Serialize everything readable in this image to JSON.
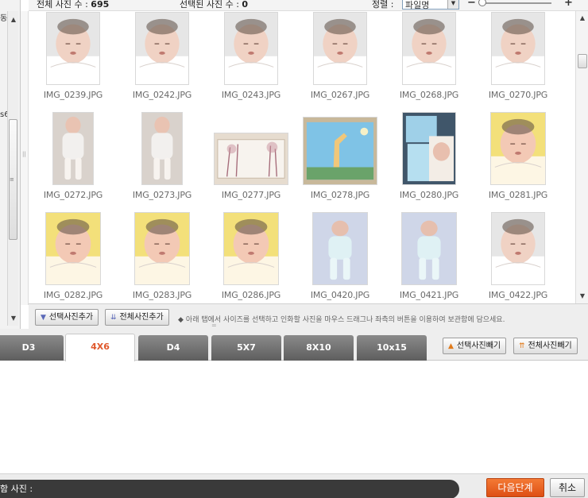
{
  "header": {
    "total_label": "전체 사진 수 : ",
    "total_count": "695",
    "selected_label": "선택된 사진 수 : ",
    "selected_count": "0",
    "sort_label": "정렬 : ",
    "sort_value": "파일명",
    "zoom_minus": "−",
    "zoom_plus": "+",
    "zoom_level": 0.0
  },
  "left_panel": {
    "frag_top": "동",
    "frag_mid": "s6"
  },
  "photos": [
    {
      "name": "IMG_0239.JPG",
      "kind": "baby-portrait"
    },
    {
      "name": "IMG_0242.JPG",
      "kind": "baby-portrait"
    },
    {
      "name": "IMG_0243.JPG",
      "kind": "baby-portrait"
    },
    {
      "name": "IMG_0267.JPG",
      "kind": "baby-portrait"
    },
    {
      "name": "IMG_0268.JPG",
      "kind": "baby-portrait"
    },
    {
      "name": "IMG_0270.JPG",
      "kind": "baby-portrait"
    },
    {
      "name": "IMG_0272.JPG",
      "kind": "baby-full"
    },
    {
      "name": "IMG_0273.JPG",
      "kind": "baby-full"
    },
    {
      "name": "IMG_0277.JPG",
      "kind": "wall-art"
    },
    {
      "name": "IMG_0278.JPG",
      "kind": "giraffe-print"
    },
    {
      "name": "IMG_0280.JPG",
      "kind": "collage"
    },
    {
      "name": "IMG_0281.JPG",
      "kind": "baby-yellow"
    },
    {
      "name": "IMG_0282.JPG",
      "kind": "baby-yellow"
    },
    {
      "name": "IMG_0283.JPG",
      "kind": "baby-yellow"
    },
    {
      "name": "IMG_0286.JPG",
      "kind": "baby-yellow"
    },
    {
      "name": "IMG_0420.JPG",
      "kind": "baby-bed"
    },
    {
      "name": "IMG_0421.JPG",
      "kind": "baby-bed"
    },
    {
      "name": "IMG_0422.JPG",
      "kind": "baby-portrait"
    }
  ],
  "actions": {
    "add_selected": "선택사진추가",
    "add_all": "전체사진추가",
    "hint": "아래 탭에서 사이즈를 선택하고 인화할 사진을 마우스 드래그나 좌측의 버튼을 이용하여 보관함에 담으세요."
  },
  "tabs": [
    {
      "label": "D3",
      "active": false
    },
    {
      "label": "4X6",
      "active": true
    },
    {
      "label": "D4",
      "active": false
    },
    {
      "label": "5X7",
      "active": false
    },
    {
      "label": "8X10",
      "active": false
    },
    {
      "label": "10x15",
      "active": false
    }
  ],
  "remove": {
    "selected": "선택사진빼기",
    "all": "전체사진빼기"
  },
  "footer": {
    "status_label": "함 사진 :",
    "next": "다음단계",
    "cancel": "취소"
  },
  "colors": {
    "accent": "#e0582b",
    "tab_inactive": "#6e6e6e",
    "next_button": "#e9611f"
  }
}
